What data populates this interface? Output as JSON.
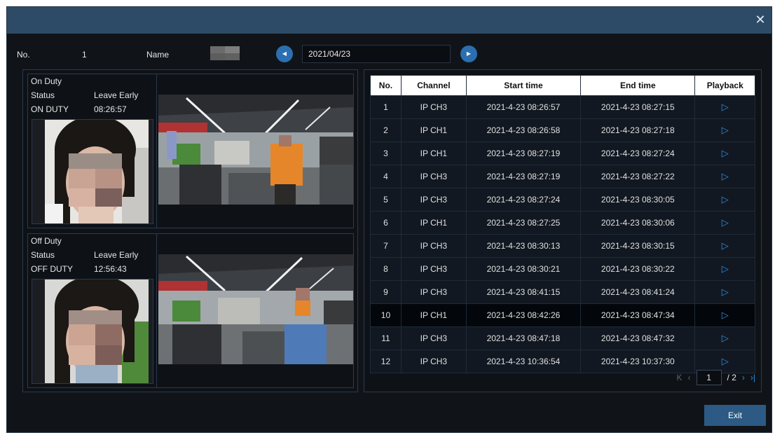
{
  "header": {
    "no_label": "No.",
    "no_value": "1",
    "name_label": "Name"
  },
  "date_nav": {
    "date": "2021/04/23",
    "prev_icon": "chevron-left-icon",
    "next_icon": "chevron-right-icon"
  },
  "on_duty": {
    "title": "On Duty",
    "status_label": "Status",
    "status_value": "Leave Early",
    "time_label": "ON DUTY",
    "time_value": "08:26:57"
  },
  "off_duty": {
    "title": "Off Duty",
    "status_label": "Status",
    "status_value": "Leave Early",
    "time_label": "OFF DUTY",
    "time_value": "12:56:43"
  },
  "table": {
    "headers": [
      "No.",
      "Channel",
      "Start time",
      "End time",
      "Playback"
    ],
    "rows": [
      [
        "1",
        "IP CH3",
        "2021-4-23 08:26:57",
        "2021-4-23 08:27:15"
      ],
      [
        "2",
        "IP CH1",
        "2021-4-23 08:26:58",
        "2021-4-23 08:27:18"
      ],
      [
        "3",
        "IP CH1",
        "2021-4-23 08:27:19",
        "2021-4-23 08:27:24"
      ],
      [
        "4",
        "IP CH3",
        "2021-4-23 08:27:19",
        "2021-4-23 08:27:22"
      ],
      [
        "5",
        "IP CH3",
        "2021-4-23 08:27:24",
        "2021-4-23 08:30:05"
      ],
      [
        "6",
        "IP CH1",
        "2021-4-23 08:27:25",
        "2021-4-23 08:30:06"
      ],
      [
        "7",
        "IP CH3",
        "2021-4-23 08:30:13",
        "2021-4-23 08:30:15"
      ],
      [
        "8",
        "IP CH3",
        "2021-4-23 08:30:21",
        "2021-4-23 08:30:22"
      ],
      [
        "9",
        "IP CH3",
        "2021-4-23 08:41:15",
        "2021-4-23 08:41:24"
      ],
      [
        "10",
        "IP CH1",
        "2021-4-23 08:42:26",
        "2021-4-23 08:47:34"
      ],
      [
        "11",
        "IP CH3",
        "2021-4-23 08:47:18",
        "2021-4-23 08:47:32"
      ],
      [
        "12",
        "IP CH3",
        "2021-4-23 10:36:54",
        "2021-4-23 10:37:30"
      ]
    ],
    "selected_row": 10
  },
  "pagination": {
    "current": "1",
    "total": "/ 2"
  },
  "buttons": {
    "exit": "Exit"
  },
  "icons": {
    "close": "close-icon",
    "play": "play-icon"
  },
  "colors": {
    "titlebar": "#2d4b66",
    "background": "#101419",
    "accent": "#2f8fe0",
    "exit_button": "#2c5a84"
  }
}
